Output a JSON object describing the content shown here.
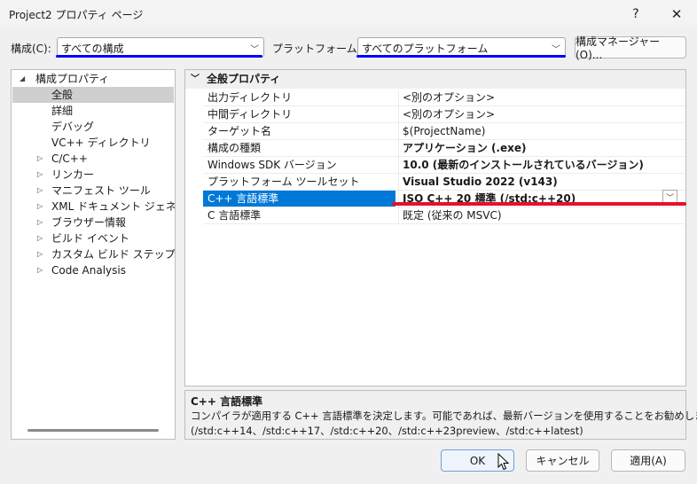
{
  "window": {
    "title": "Project2 プロパティ ページ",
    "help_glyph": "?",
    "close_glyph": "✕"
  },
  "toolbar": {
    "config_label": "構成(C):",
    "config_value": "すべての構成",
    "platform_label": "プラットフォーム(P):",
    "platform_value": "すべてのプラットフォーム",
    "config_manager_label": "構成マネージャー(O)..."
  },
  "tree": {
    "root": "構成プロパティ",
    "items": [
      {
        "label": "全般",
        "expandable": false,
        "selected": true
      },
      {
        "label": "詳細",
        "expandable": false
      },
      {
        "label": "デバッグ",
        "expandable": false
      },
      {
        "label": "VC++ ディレクトリ",
        "expandable": false
      },
      {
        "label": "C/C++",
        "expandable": true
      },
      {
        "label": "リンカー",
        "expandable": true
      },
      {
        "label": "マニフェスト ツール",
        "expandable": true
      },
      {
        "label": "XML ドキュメント ジェネレーター",
        "expandable": true
      },
      {
        "label": "ブラウザー情報",
        "expandable": true
      },
      {
        "label": "ビルド イベント",
        "expandable": true
      },
      {
        "label": "カスタム ビルド ステップ",
        "expandable": true
      },
      {
        "label": "Code Analysis",
        "expandable": true
      }
    ]
  },
  "grid": {
    "section": "全般プロパティ",
    "rows": [
      {
        "name": "出力ディレクトリ",
        "value": "<別のオプション>",
        "bold": false
      },
      {
        "name": "中間ディレクトリ",
        "value": "<別のオプション>",
        "bold": false
      },
      {
        "name": "ターゲット名",
        "value": "$(ProjectName)",
        "bold": false
      },
      {
        "name": "構成の種類",
        "value": "アプリケーション (.exe)",
        "bold": true
      },
      {
        "name": "Windows SDK バージョン",
        "value": "10.0 (最新のインストールされているバージョン)",
        "bold": true
      },
      {
        "name": "プラットフォーム ツールセット",
        "value": "Visual Studio 2022 (v143)",
        "bold": true
      },
      {
        "name": "C++ 言語標準",
        "value": "ISO C++ 20 標準 (/std:c++20)",
        "bold": true,
        "selected": true
      },
      {
        "name": "C 言語標準",
        "value": "既定 (従来の MSVC)",
        "bold": false
      }
    ]
  },
  "description": {
    "title": "C++ 言語標準",
    "line1": "コンパイラが適用する C++ 言語標準を決定します。可能であれば、最新バージョンを使用することをお勧めします。",
    "line2": "(/std:c++14、/std:c++17、/std:c++20、/std:c++23preview、/std:c++latest)"
  },
  "buttons": {
    "ok": "OK",
    "cancel": "キャンセル",
    "apply": "適用(A)"
  },
  "colors": {
    "accent": "#0078d7",
    "annotation_blue": "#0000ff",
    "annotation_red": "#e8102a"
  }
}
